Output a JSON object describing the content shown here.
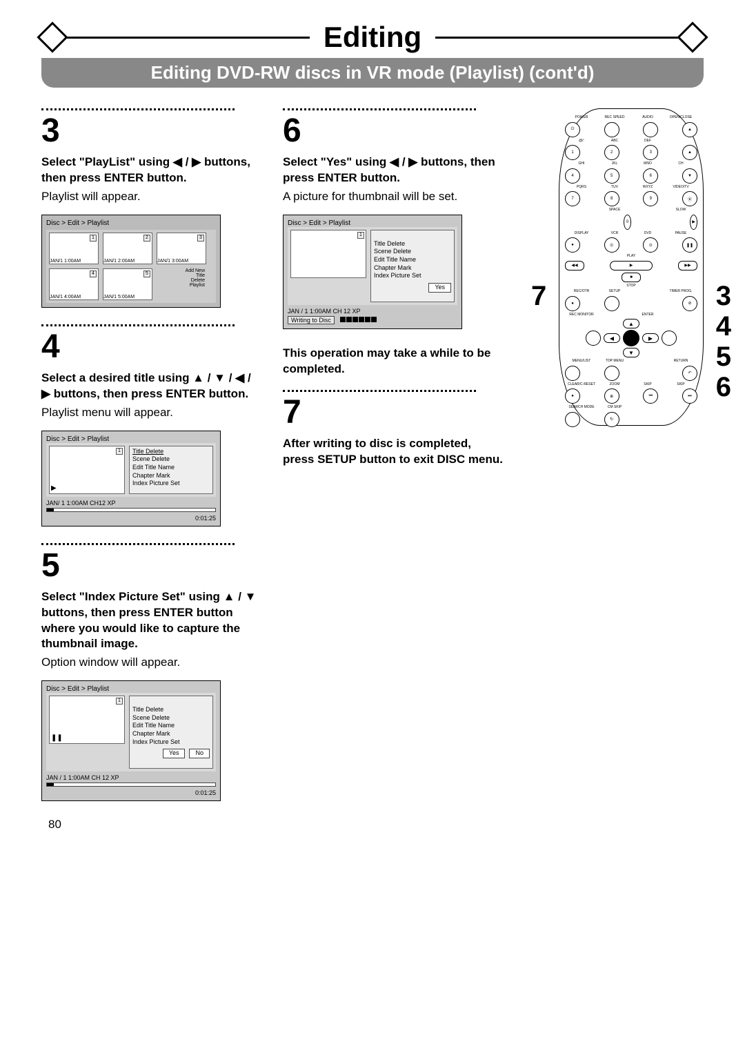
{
  "header": {
    "title": "Editing",
    "subtitle": "Editing DVD-RW discs in VR mode (Playlist) (cont'd)"
  },
  "steps": {
    "s3": {
      "num": "3",
      "bold": "Select \"PlayList\" using ◀ / ▶ buttons, then press ENTER button.",
      "text": "Playlist will appear."
    },
    "s4": {
      "num": "4",
      "bold": "Select a desired title using ▲ / ▼ / ◀ / ▶ buttons, then press ENTER button.",
      "text": "Playlist menu will appear."
    },
    "s5": {
      "num": "5",
      "bold": "Select \"Index Picture Set\" using ▲ / ▼ buttons, then press ENTER button where you would like to capture the thumbnail image.",
      "text": "Option window will appear."
    },
    "s6": {
      "num": "6",
      "bold": "Select \"Yes\" using ◀ / ▶ buttons, then press ENTER button.",
      "text": "A picture for thumbnail will be set.",
      "note": "This operation may take a while to be completed."
    },
    "s7": {
      "num": "7",
      "bold": "After writing to disc is completed, press SETUP button to exit DISC menu."
    }
  },
  "shot1": {
    "crumb": "Disc > Edit > Playlist",
    "thumbs": [
      {
        "n": "1",
        "label": "JAN/1  1:00AM"
      },
      {
        "n": "2",
        "label": "JAN/1  2:00AM"
      },
      {
        "n": "3",
        "label": "JAN/1  3:00AM"
      },
      {
        "n": "4",
        "label": "JAN/1  4:00AM"
      },
      {
        "n": "5",
        "label": "JAN/1  5:00AM"
      }
    ],
    "add": "Add New\nTitle\nDelete\nPlaylist"
  },
  "shot2": {
    "crumb": "Disc > Edit > Playlist",
    "opts": [
      "Title Delete",
      "Scene Delete",
      "Edit Title Name",
      "Chapter Mark",
      "Index Picture Set"
    ],
    "status_left": "JAN/ 1   1:00AM  CH12    XP",
    "time": "0:01:25"
  },
  "shot3": {
    "crumb": "Disc > Edit > Playlist",
    "opts_txt": "Title Delete\nScene Delete\nEdit Title Name\nChapter Mark\nIndex Picture Set",
    "yes": "Yes",
    "no": "No",
    "status_left": "JAN / 1   1:00AM  CH 12    XP",
    "pause": "❚❚",
    "time": "0:01:25"
  },
  "shot4": {
    "crumb": "Disc > Edit > Playlist",
    "opts_txt": "Title Delete\nScene Delete\nEdit Title Name\nChapter Mark\nIndex Picture Set",
    "yes": "Yes",
    "status_left": "JAN / 1   1:00AM  CH 12    XP",
    "writing": "Writing to Disc"
  },
  "remote_side": {
    "left": "7",
    "right": [
      "3",
      "4",
      "5",
      "6"
    ]
  },
  "remote_labels": {
    "r1": [
      "POWER",
      "REC SPEED",
      "AUDIO",
      "OPEN/CLOSE"
    ],
    "r2": [
      "@/:",
      "ABC",
      "DEF",
      ""
    ],
    "keypad": [
      "1",
      "2",
      "3",
      "CH▲",
      "4",
      "5",
      "6",
      "CH▼",
      "7",
      "8",
      "9",
      "VIDEO/TV",
      "",
      "0",
      "",
      ""
    ],
    "r3": [
      "GHI",
      "JKL",
      "MNO",
      "CH"
    ],
    "r4": [
      "PQRS",
      "TUV",
      "WXYZ",
      "VIDEO/TV"
    ],
    "r5": [
      "",
      "SPACE",
      "",
      "SLOW"
    ],
    "r6": [
      "DISPLAY",
      "VCR",
      "DVD",
      "PAUSE"
    ],
    "play": "PLAY",
    "rew": "◀◀",
    "ffw": "▶▶",
    "stop": "STOP",
    "r7": [
      "REC/OTR",
      "SETUP",
      "",
      "TIMER PROG."
    ],
    "r8": [
      "REC MONITOR",
      "",
      "ENTER",
      ""
    ],
    "r9": [
      "MENU/LIST",
      "TOP MENU",
      "",
      "RETURN"
    ],
    "r10": [
      "CLEAR/C-RESET",
      "ZOOM",
      "SKIP",
      "SKIP"
    ],
    "r11": [
      "SEARCH MODE",
      "CM SKIP",
      "",
      ""
    ]
  },
  "page_number": "80"
}
